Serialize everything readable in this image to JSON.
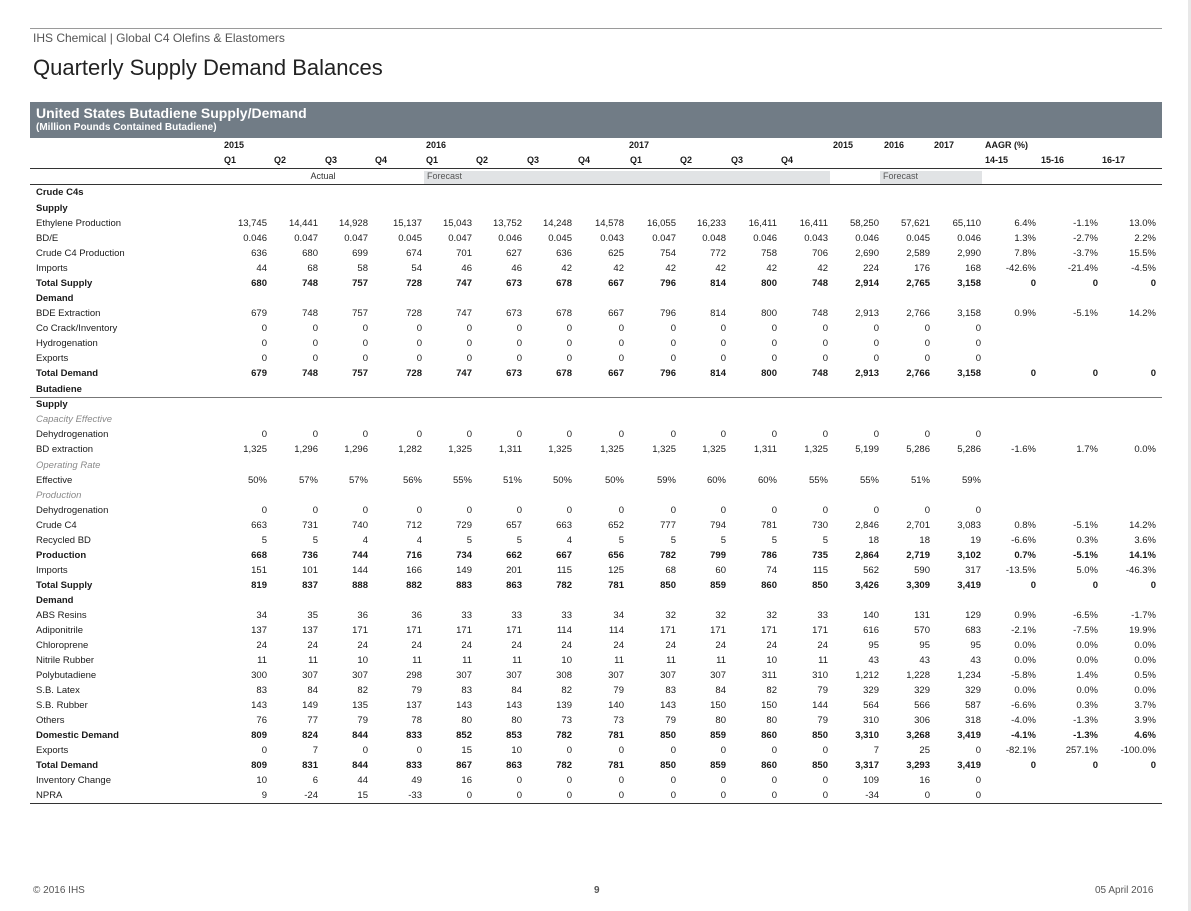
{
  "header": {
    "source": "IHS Chemical | Global C4 Olefins & Elastomers",
    "title": "Quarterly Supply Demand Balances"
  },
  "table": {
    "title": "United States Butadiene Supply/Demand",
    "subtitle": "(Million Pounds Contained Butadiene)",
    "year_labels": [
      "2015",
      "2016",
      "2017",
      "2015",
      "2016",
      "2017",
      "AAGR (%)"
    ],
    "quarter_labels": [
      "Q1",
      "Q2",
      "Q3",
      "Q4",
      "Q1",
      "Q2",
      "Q3",
      "Q4",
      "Q1",
      "Q2",
      "Q3",
      "Q4",
      "14-15",
      "15-16",
      "16-17"
    ],
    "actual_label": "Actual",
    "forecast_label": "Forecast",
    "forecast_label2": "Forecast",
    "rows": [
      {
        "label": "Crude C4s",
        "type": "section",
        "values": []
      },
      {
        "label": "Supply",
        "type": "group",
        "values": []
      },
      {
        "label": "Ethylene Production",
        "type": "data",
        "values": [
          "13,745",
          "14,441",
          "14,928",
          "15,137",
          "15,043",
          "13,752",
          "14,248",
          "14,578",
          "16,055",
          "16,233",
          "16,411",
          "16,411",
          "58,250",
          "57,621",
          "65,110",
          "6.4%",
          "-1.1%",
          "13.0%"
        ]
      },
      {
        "label": "BD/E",
        "type": "data",
        "values": [
          "0.046",
          "0.047",
          "0.047",
          "0.045",
          "0.047",
          "0.046",
          "0.045",
          "0.043",
          "0.047",
          "0.048",
          "0.046",
          "0.043",
          "0.046",
          "0.045",
          "0.046",
          "1.3%",
          "-2.7%",
          "2.2%"
        ]
      },
      {
        "label": "Crude C4 Production",
        "type": "data",
        "values": [
          "636",
          "680",
          "699",
          "674",
          "701",
          "627",
          "636",
          "625",
          "754",
          "772",
          "758",
          "706",
          "2,690",
          "2,589",
          "2,990",
          "7.8%",
          "-3.7%",
          "15.5%"
        ]
      },
      {
        "label": "Imports",
        "type": "data",
        "values": [
          "44",
          "68",
          "58",
          "54",
          "46",
          "46",
          "42",
          "42",
          "42",
          "42",
          "42",
          "42",
          "224",
          "176",
          "168",
          "-42.6%",
          "-21.4%",
          "-4.5%"
        ]
      },
      {
        "label": "Total Supply",
        "type": "total",
        "values": [
          "680",
          "748",
          "757",
          "728",
          "747",
          "673",
          "678",
          "667",
          "796",
          "814",
          "800",
          "748",
          "2,914",
          "2,765",
          "3,158",
          "0",
          "0",
          "0"
        ]
      },
      {
        "label": "Demand",
        "type": "group",
        "values": []
      },
      {
        "label": "BDE Extraction",
        "type": "data",
        "values": [
          "679",
          "748",
          "757",
          "728",
          "747",
          "673",
          "678",
          "667",
          "796",
          "814",
          "800",
          "748",
          "2,913",
          "2,766",
          "3,158",
          "0.9%",
          "-5.1%",
          "14.2%"
        ]
      },
      {
        "label": "Co Crack/Inventory",
        "type": "data",
        "values": [
          "0",
          "0",
          "0",
          "0",
          "0",
          "0",
          "0",
          "0",
          "0",
          "0",
          "0",
          "0",
          "0",
          "0",
          "0",
          "",
          "",
          ""
        ]
      },
      {
        "label": "Hydrogenation",
        "type": "data",
        "values": [
          "0",
          "0",
          "0",
          "0",
          "0",
          "0",
          "0",
          "0",
          "0",
          "0",
          "0",
          "0",
          "0",
          "0",
          "0",
          "",
          "",
          ""
        ]
      },
      {
        "label": "Exports",
        "type": "data",
        "values": [
          "0",
          "0",
          "0",
          "0",
          "0",
          "0",
          "0",
          "0",
          "0",
          "0",
          "0",
          "0",
          "0",
          "0",
          "0",
          "",
          "",
          ""
        ]
      },
      {
        "label": "Total Demand",
        "type": "total",
        "values": [
          "679",
          "748",
          "757",
          "728",
          "747",
          "673",
          "678",
          "667",
          "796",
          "814",
          "800",
          "748",
          "2,913",
          "2,766",
          "3,158",
          "0",
          "0",
          "0"
        ]
      },
      {
        "label": "Butadiene",
        "type": "section",
        "values": []
      },
      {
        "label": "Supply",
        "type": "group",
        "values": []
      },
      {
        "label": "Capacity Effective",
        "type": "italic",
        "values": []
      },
      {
        "label": "Dehydrogenation",
        "type": "data",
        "values": [
          "0",
          "0",
          "0",
          "0",
          "0",
          "0",
          "0",
          "0",
          "0",
          "0",
          "0",
          "0",
          "0",
          "0",
          "0",
          "",
          "",
          ""
        ]
      },
      {
        "label": "BD extraction",
        "type": "data",
        "values": [
          "1,325",
          "1,296",
          "1,296",
          "1,282",
          "1,325",
          "1,311",
          "1,325",
          "1,325",
          "1,325",
          "1,325",
          "1,311",
          "1,325",
          "5,199",
          "5,286",
          "5,286",
          "-1.6%",
          "1.7%",
          "0.0%"
        ]
      },
      {
        "label": "Operating Rate",
        "type": "italic",
        "values": []
      },
      {
        "label": "Effective",
        "type": "data",
        "values": [
          "50%",
          "57%",
          "57%",
          "56%",
          "55%",
          "51%",
          "50%",
          "50%",
          "59%",
          "60%",
          "60%",
          "55%",
          "55%",
          "51%",
          "59%",
          "",
          "",
          ""
        ]
      },
      {
        "label": "Production",
        "type": "italic",
        "values": []
      },
      {
        "label": "Dehydrogenation",
        "type": "data",
        "values": [
          "0",
          "0",
          "0",
          "0",
          "0",
          "0",
          "0",
          "0",
          "0",
          "0",
          "0",
          "0",
          "0",
          "0",
          "0",
          "",
          "",
          ""
        ]
      },
      {
        "label": "Crude C4",
        "type": "data",
        "values": [
          "663",
          "731",
          "740",
          "712",
          "729",
          "657",
          "663",
          "652",
          "777",
          "794",
          "781",
          "730",
          "2,846",
          "2,701",
          "3,083",
          "0.8%",
          "-5.1%",
          "14.2%"
        ]
      },
      {
        "label": "Recycled BD",
        "type": "data",
        "values": [
          "5",
          "5",
          "4",
          "4",
          "5",
          "5",
          "4",
          "5",
          "5",
          "5",
          "5",
          "5",
          "18",
          "18",
          "19",
          "-6.6%",
          "0.3%",
          "3.6%"
        ]
      },
      {
        "label": "Production",
        "type": "total",
        "values": [
          "668",
          "736",
          "744",
          "716",
          "734",
          "662",
          "667",
          "656",
          "782",
          "799",
          "786",
          "735",
          "2,864",
          "2,719",
          "3,102",
          "0.7%",
          "-5.1%",
          "14.1%"
        ]
      },
      {
        "label": "Imports",
        "type": "data",
        "values": [
          "151",
          "101",
          "144",
          "166",
          "149",
          "201",
          "115",
          "125",
          "68",
          "60",
          "74",
          "115",
          "562",
          "590",
          "317",
          "-13.5%",
          "5.0%",
          "-46.3%"
        ]
      },
      {
        "label": "Total Supply",
        "type": "total",
        "values": [
          "819",
          "837",
          "888",
          "882",
          "883",
          "863",
          "782",
          "781",
          "850",
          "859",
          "860",
          "850",
          "3,426",
          "3,309",
          "3,419",
          "0",
          "0",
          "0"
        ]
      },
      {
        "label": "Demand",
        "type": "group",
        "values": []
      },
      {
        "label": "ABS Resins",
        "type": "data",
        "values": [
          "34",
          "35",
          "36",
          "36",
          "33",
          "33",
          "33",
          "34",
          "32",
          "32",
          "32",
          "33",
          "140",
          "131",
          "129",
          "0.9%",
          "-6.5%",
          "-1.7%"
        ]
      },
      {
        "label": "Adiponitrile",
        "type": "data",
        "values": [
          "137",
          "137",
          "171",
          "171",
          "171",
          "171",
          "114",
          "114",
          "171",
          "171",
          "171",
          "171",
          "616",
          "570",
          "683",
          "-2.1%",
          "-7.5%",
          "19.9%"
        ]
      },
      {
        "label": "Chloroprene",
        "type": "data",
        "values": [
          "24",
          "24",
          "24",
          "24",
          "24",
          "24",
          "24",
          "24",
          "24",
          "24",
          "24",
          "24",
          "95",
          "95",
          "95",
          "0.0%",
          "0.0%",
          "0.0%"
        ]
      },
      {
        "label": "Nitrile Rubber",
        "type": "data",
        "values": [
          "11",
          "11",
          "10",
          "11",
          "11",
          "11",
          "10",
          "11",
          "11",
          "11",
          "10",
          "11",
          "43",
          "43",
          "43",
          "0.0%",
          "0.0%",
          "0.0%"
        ]
      },
      {
        "label": "Polybutadiene",
        "type": "data",
        "values": [
          "300",
          "307",
          "307",
          "298",
          "307",
          "307",
          "308",
          "307",
          "307",
          "307",
          "311",
          "310",
          "1,212",
          "1,228",
          "1,234",
          "-5.8%",
          "1.4%",
          "0.5%"
        ]
      },
      {
        "label": "S.B. Latex",
        "type": "data",
        "values": [
          "83",
          "84",
          "82",
          "79",
          "83",
          "84",
          "82",
          "79",
          "83",
          "84",
          "82",
          "79",
          "329",
          "329",
          "329",
          "0.0%",
          "0.0%",
          "0.0%"
        ]
      },
      {
        "label": "S.B. Rubber",
        "type": "data",
        "values": [
          "143",
          "149",
          "135",
          "137",
          "143",
          "143",
          "139",
          "140",
          "143",
          "150",
          "150",
          "144",
          "564",
          "566",
          "587",
          "-6.6%",
          "0.3%",
          "3.7%"
        ]
      },
      {
        "label": "Others",
        "type": "data",
        "values": [
          "76",
          "77",
          "79",
          "78",
          "80",
          "80",
          "73",
          "73",
          "79",
          "80",
          "80",
          "79",
          "310",
          "306",
          "318",
          "-4.0%",
          "-1.3%",
          "3.9%"
        ]
      },
      {
        "label": "Domestic Demand",
        "type": "total",
        "values": [
          "809",
          "824",
          "844",
          "833",
          "852",
          "853",
          "782",
          "781",
          "850",
          "859",
          "860",
          "850",
          "3,310",
          "3,268",
          "3,419",
          "-4.1%",
          "-1.3%",
          "4.6%"
        ]
      },
      {
        "label": "Exports",
        "type": "data",
        "values": [
          "0",
          "7",
          "0",
          "0",
          "15",
          "10",
          "0",
          "0",
          "0",
          "0",
          "0",
          "0",
          "7",
          "25",
          "0",
          "-82.1%",
          "257.1%",
          "-100.0%"
        ]
      },
      {
        "label": "Total Demand",
        "type": "total",
        "values": [
          "809",
          "831",
          "844",
          "833",
          "867",
          "863",
          "782",
          "781",
          "850",
          "859",
          "860",
          "850",
          "3,317",
          "3,293",
          "3,419",
          "0",
          "0",
          "0"
        ]
      },
      {
        "label": "Inventory Change",
        "type": "data",
        "values": [
          "10",
          "6",
          "44",
          "49",
          "16",
          "0",
          "0",
          "0",
          "0",
          "0",
          "0",
          "0",
          "109",
          "16",
          "0",
          "",
          "",
          ""
        ]
      },
      {
        "label": "NPRA",
        "type": "data",
        "values": [
          "9",
          "-24",
          "15",
          "-33",
          "0",
          "0",
          "0",
          "0",
          "0",
          "0",
          "0",
          "0",
          "-34",
          "0",
          "0",
          "",
          "",
          ""
        ]
      }
    ]
  },
  "footer": {
    "copyright": "© 2016 IHS",
    "page": "9",
    "date": "05 April 2016"
  }
}
